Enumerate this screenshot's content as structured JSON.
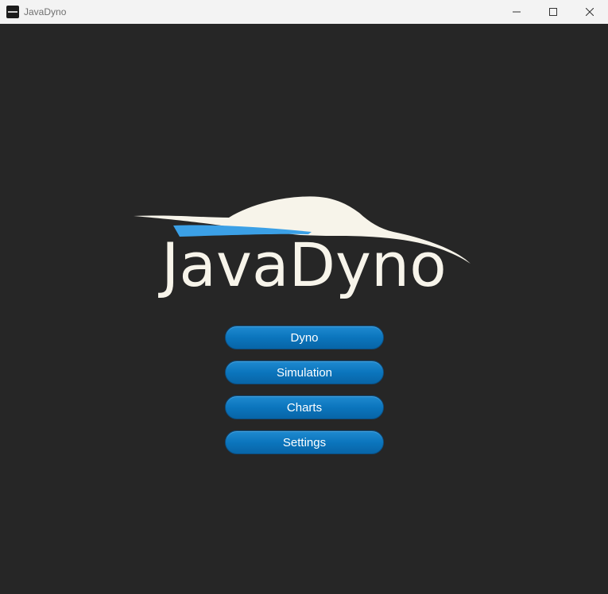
{
  "window": {
    "title": "JavaDyno",
    "controls": {
      "minimize": "minimize-icon",
      "maximize": "maximize-icon",
      "close": "close-icon"
    }
  },
  "logo": {
    "text": "JavaDyno",
    "text_color": "#f7f4ea",
    "accent_color": "#3ba0e6"
  },
  "menu": {
    "buttons": [
      {
        "label": "Dyno"
      },
      {
        "label": "Simulation"
      },
      {
        "label": "Charts"
      },
      {
        "label": "Settings"
      }
    ],
    "button_color": "#0b75bd"
  },
  "theme": {
    "background": "#262626",
    "titlebar": "#f3f3f3"
  }
}
